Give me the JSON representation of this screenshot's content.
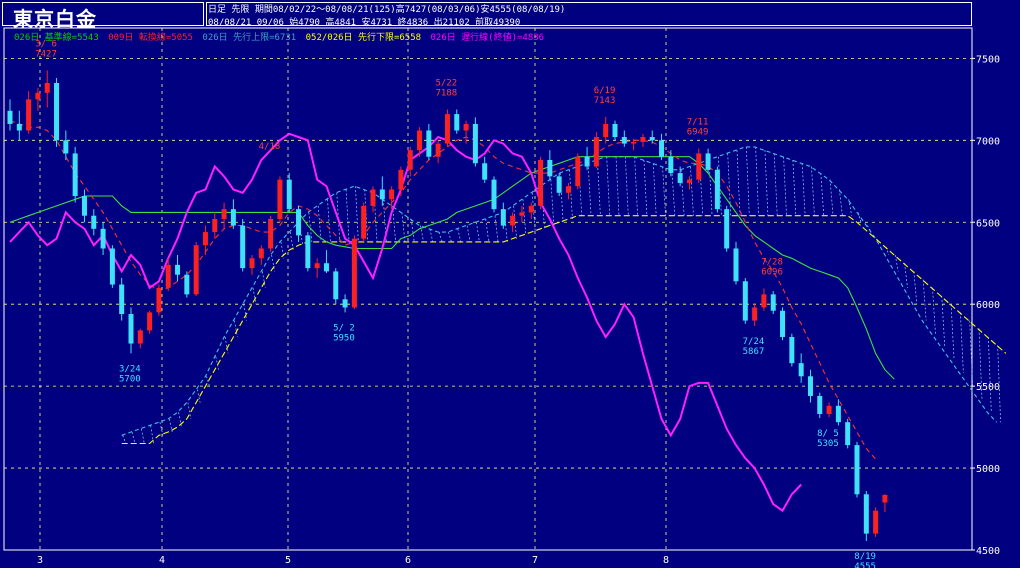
{
  "header": {
    "title": "東京白金",
    "info_line1": "日足 先限 期間08/02/22〜08/08/21(125)高7427(08/03/06)安4555(08/08/19)",
    "info_line2": "08/08/21 09/06 始4790 高4841 安4731 終4836 出21102 前取49390"
  },
  "legend": {
    "items": [
      {
        "label": "026日 基準線=5543",
        "color": "#00d000"
      },
      {
        "label": "009日 転換線=5055",
        "color": "#ff2020"
      },
      {
        "label": "026日 先行上限=6731",
        "color": "#40a0c0"
      },
      {
        "label": "052/026日 先行下限=6558",
        "color": "#ffff00"
      },
      {
        "label": "026日 遅行線(終値)=4836",
        "color": "#ff00ff"
      }
    ]
  },
  "chart_data": {
    "type": "candlestick",
    "ylim": [
      4500,
      7600
    ],
    "yticks": [
      4500,
      5000,
      5500,
      6000,
      6500,
      7000,
      7500
    ],
    "xticks": [
      "3",
      "4",
      "5",
      "6",
      "7",
      "8"
    ],
    "grid": true,
    "annotations": [
      {
        "label": "3/ 6",
        "value": "7427",
        "price": 7427,
        "color": "#ff4040"
      },
      {
        "label": "3/24",
        "value": "5700",
        "price": 5700,
        "color": "#40e0ff"
      },
      {
        "label": "4/18",
        "value": "",
        "price": 6800,
        "color": "#ff4040"
      },
      {
        "label": "5/ 2",
        "value": "5950",
        "price": 5950,
        "color": "#40e0ff"
      },
      {
        "label": "5/22",
        "value": "7188",
        "price": 7188,
        "color": "#ff4040"
      },
      {
        "label": "6/19",
        "value": "7143",
        "price": 7143,
        "color": "#ff4040"
      },
      {
        "label": "7/11",
        "value": "6949",
        "price": 6949,
        "color": "#ff4040"
      },
      {
        "label": "7/28",
        "value": "6096",
        "price": 6096,
        "color": "#ff4040"
      },
      {
        "label": "7/24",
        "value": "5867",
        "price": 5867,
        "color": "#40e0ff"
      },
      {
        "label": "8/ 5",
        "value": "5305",
        "price": 5305,
        "color": "#40e0ff"
      },
      {
        "label": "8/19",
        "value": "4555",
        "price": 4555,
        "color": "#40e0ff"
      }
    ],
    "candles": [
      [
        7180,
        7250,
        7060,
        7100
      ],
      [
        7100,
        7180,
        7000,
        7060
      ],
      [
        7060,
        7300,
        7040,
        7250
      ],
      [
        7250,
        7320,
        7180,
        7290
      ],
      [
        7290,
        7427,
        7200,
        7350
      ],
      [
        7350,
        7380,
        6960,
        7000
      ],
      [
        7000,
        7060,
        6880,
        6920
      ],
      [
        6920,
        6960,
        6620,
        6660
      ],
      [
        6660,
        6700,
        6500,
        6540
      ],
      [
        6540,
        6580,
        6420,
        6460
      ],
      [
        6460,
        6500,
        6300,
        6340
      ],
      [
        6340,
        6360,
        6100,
        6120
      ],
      [
        6120,
        6160,
        5900,
        5940
      ],
      [
        5940,
        5980,
        5700,
        5760
      ],
      [
        5760,
        5850,
        5730,
        5840
      ],
      [
        5840,
        5960,
        5820,
        5950
      ],
      [
        5950,
        6120,
        5930,
        6100
      ],
      [
        6100,
        6280,
        6080,
        6240
      ],
      [
        6240,
        6300,
        6140,
        6180
      ],
      [
        6180,
        6200,
        6040,
        6060
      ],
      [
        6060,
        6380,
        6050,
        6360
      ],
      [
        6360,
        6480,
        6300,
        6440
      ],
      [
        6440,
        6560,
        6400,
        6520
      ],
      [
        6520,
        6620,
        6460,
        6580
      ],
      [
        6580,
        6640,
        6460,
        6480
      ],
      [
        6480,
        6520,
        6200,
        6220
      ],
      [
        6220,
        6300,
        6180,
        6280
      ],
      [
        6280,
        6360,
        6240,
        6340
      ],
      [
        6340,
        6540,
        6320,
        6520
      ],
      [
        6520,
        6780,
        6500,
        6760
      ],
      [
        6760,
        6800,
        6560,
        6580
      ],
      [
        6580,
        6600,
        6380,
        6420
      ],
      [
        6420,
        6440,
        6200,
        6220
      ],
      [
        6220,
        6280,
        6160,
        6250
      ],
      [
        6250,
        6330,
        6190,
        6200
      ],
      [
        6200,
        6220,
        6000,
        6030
      ],
      [
        6030,
        6060,
        5950,
        5980
      ],
      [
        5980,
        6420,
        5970,
        6400
      ],
      [
        6400,
        6620,
        6380,
        6600
      ],
      [
        6600,
        6720,
        6560,
        6700
      ],
      [
        6700,
        6780,
        6600,
        6640
      ],
      [
        6640,
        6720,
        6580,
        6700
      ],
      [
        6700,
        6840,
        6660,
        6820
      ],
      [
        6820,
        6960,
        6780,
        6940
      ],
      [
        6940,
        7080,
        6900,
        7060
      ],
      [
        7060,
        7100,
        6880,
        6900
      ],
      [
        6900,
        7000,
        6860,
        6980
      ],
      [
        6980,
        7188,
        6960,
        7160
      ],
      [
        7160,
        7188,
        7040,
        7060
      ],
      [
        7060,
        7120,
        6980,
        7100
      ],
      [
        7100,
        7140,
        6840,
        6860
      ],
      [
        6860,
        6900,
        6740,
        6760
      ],
      [
        6760,
        6780,
        6560,
        6580
      ],
      [
        6580,
        6620,
        6460,
        6480
      ],
      [
        6480,
        6560,
        6440,
        6540
      ],
      [
        6540,
        6600,
        6500,
        6560
      ],
      [
        6560,
        6620,
        6520,
        6600
      ],
      [
        6600,
        6900,
        6580,
        6880
      ],
      [
        6880,
        6940,
        6760,
        6780
      ],
      [
        6780,
        6800,
        6660,
        6680
      ],
      [
        6680,
        6740,
        6640,
        6720
      ],
      [
        6720,
        6920,
        6700,
        6900
      ],
      [
        6900,
        6960,
        6820,
        6840
      ],
      [
        6840,
        7050,
        6830,
        7020
      ],
      [
        7020,
        7143,
        6980,
        7100
      ],
      [
        7100,
        7120,
        7000,
        7020
      ],
      [
        7020,
        7060,
        6960,
        6980
      ],
      [
        6980,
        7010,
        6940,
        6990
      ],
      [
        6990,
        7040,
        6960,
        7020
      ],
      [
        7020,
        7060,
        6980,
        7000
      ],
      [
        7000,
        7040,
        6880,
        6900
      ],
      [
        6900,
        6940,
        6780,
        6800
      ],
      [
        6800,
        6840,
        6720,
        6740
      ],
      [
        6740,
        6780,
        6700,
        6760
      ],
      [
        6760,
        6949,
        6740,
        6920
      ],
      [
        6920,
        6949,
        6800,
        6820
      ],
      [
        6820,
        6840,
        6560,
        6580
      ],
      [
        6580,
        6600,
        6320,
        6340
      ],
      [
        6340,
        6380,
        6120,
        6140
      ],
      [
        6140,
        6160,
        5880,
        5900
      ],
      [
        5900,
        6000,
        5867,
        5980
      ],
      [
        5980,
        6096,
        5960,
        6060
      ],
      [
        6060,
        6080,
        5940,
        5960
      ],
      [
        5960,
        5980,
        5780,
        5800
      ],
      [
        5800,
        5820,
        5620,
        5640
      ],
      [
        5640,
        5700,
        5520,
        5560
      ],
      [
        5560,
        5600,
        5400,
        5440
      ],
      [
        5440,
        5460,
        5305,
        5330
      ],
      [
        5330,
        5400,
        5310,
        5380
      ],
      [
        5380,
        5420,
        5260,
        5280
      ],
      [
        5280,
        5300,
        5120,
        5140
      ],
      [
        5140,
        5160,
        4820,
        4840
      ],
      [
        4840,
        4860,
        4555,
        4600
      ],
      [
        4600,
        4760,
        4580,
        4740
      ],
      [
        4790,
        4841,
        4731,
        4836
      ]
    ],
    "tenkan_line": [
      7120,
      7100,
      7080,
      7080,
      7060,
      7000,
      6900,
      6800,
      6720,
      6640,
      6560,
      6460,
      6360,
      6260,
      6180,
      6120,
      6080,
      6100,
      6140,
      6180,
      6240,
      6320,
      6400,
      6460,
      6480,
      6480,
      6460,
      6440,
      6440,
      6480,
      6560,
      6600,
      6580,
      6540,
      6480,
      6420,
      6360,
      6380,
      6420,
      6500,
      6560,
      6620,
      6680,
      6760,
      6820,
      6880,
      6920,
      6960,
      7000,
      7020,
      7000,
      6960,
      6900,
      6860,
      6840,
      6820,
      6800,
      6800,
      6800,
      6820,
      6840,
      6860,
      6880,
      6920,
      6960,
      6980,
      6990,
      7000,
      7000,
      6990,
      6960,
      6920,
      6880,
      6860,
      6860,
      6840,
      6800,
      6720,
      6620,
      6500,
      6380,
      6280,
      6200,
      6100,
      5980,
      5880,
      5760,
      5640,
      5520,
      5420,
      5320,
      5220,
      5120,
      5055
    ],
    "kijun_line": [
      6500,
      6520,
      6540,
      6560,
      6580,
      6600,
      6620,
      6640,
      6660,
      6660,
      6660,
      6660,
      6600,
      6560,
      6560,
      6560,
      6560,
      6560,
      6560,
      6560,
      6560,
      6560,
      6560,
      6560,
      6560,
      6560,
      6560,
      6560,
      6560,
      6560,
      6560,
      6560,
      6480,
      6420,
      6380,
      6360,
      6350,
      6340,
      6340,
      6340,
      6340,
      6340,
      6400,
      6420,
      6460,
      6480,
      6500,
      6520,
      6560,
      6580,
      6600,
      6620,
      6640,
      6680,
      6720,
      6760,
      6800,
      6820,
      6840,
      6860,
      6880,
      6900,
      6900,
      6900,
      6900,
      6900,
      6900,
      6900,
      6900,
      6900,
      6900,
      6900,
      6900,
      6900,
      6860,
      6800,
      6720,
      6640,
      6560,
      6480,
      6420,
      6380,
      6340,
      6300,
      6280,
      6250,
      6220,
      6200,
      6180,
      6160,
      6100,
      5980,
      5850,
      5700,
      5600,
      5543
    ],
    "span_a": [
      5200,
      5220,
      5240,
      5260,
      5280,
      5300,
      5340,
      5400,
      5480,
      5560,
      5680,
      5800,
      5900,
      6000,
      6100,
      6200,
      6300,
      6380,
      6440,
      6500,
      6560,
      6600,
      6640,
      6680,
      6700,
      6720,
      6700,
      6680,
      6640,
      6600,
      6560,
      6520,
      6480,
      6460,
      6440,
      6440,
      6460,
      6480,
      6500,
      6520,
      6540,
      6560,
      6600,
      6640,
      6680,
      6720,
      6760,
      6800,
      6820,
      6840,
      6860,
      6880,
      6900,
      6900,
      6900,
      6900,
      6880,
      6860,
      6840,
      6820,
      6820,
      6840,
      6860,
      6880,
      6900,
      6920,
      6940,
      6960,
      6960,
      6940,
      6920,
      6900,
      6880,
      6860,
      6840,
      6800,
      6760,
      6700,
      6640,
      6560,
      6480,
      6400,
      6300,
      6200,
      6100,
      6000,
      5900,
      5820,
      5740,
      5660,
      5580,
      5500,
      5420,
      5340,
      5280
    ],
    "span_b": [
      5150,
      5150,
      5150,
      5150,
      5200,
      5220,
      5250,
      5300,
      5400,
      5500,
      5600,
      5700,
      5800,
      5900,
      6000,
      6100,
      6200,
      6280,
      6330,
      6360,
      6380,
      6380,
      6380,
      6380,
      6380,
      6380,
      6380,
      6380,
      6380,
      6380,
      6380,
      6380,
      6380,
      6380,
      6380,
      6380,
      6380,
      6380,
      6380,
      6380,
      6380,
      6380,
      6400,
      6420,
      6440,
      6460,
      6480,
      6500,
      6520,
      6540,
      6540,
      6540,
      6540,
      6540,
      6540,
      6540,
      6540,
      6540,
      6540,
      6540,
      6540,
      6540,
      6540,
      6540,
      6540,
      6540,
      6540,
      6540,
      6540,
      6540,
      6540,
      6540,
      6540,
      6540,
      6540,
      6540,
      6540,
      6540,
      6540,
      6500,
      6450,
      6400,
      6350,
      6300,
      6250,
      6200,
      6150,
      6100,
      6050,
      6000,
      5950,
      5900,
      5850,
      5800,
      5750,
      5700
    ],
    "chikou_line": [
      6380,
      6440,
      6500,
      6420,
      6360,
      6400,
      6560,
      6500,
      6460,
      6360,
      6420,
      6300,
      6200,
      6300,
      6240,
      6100,
      6140,
      6280,
      6400,
      6560,
      6680,
      6700,
      6840,
      6780,
      6700,
      6680,
      6760,
      6880,
      6940,
      7000,
      7040,
      7020,
      7000,
      6760,
      6720,
      6560,
      6400,
      6360,
      6260,
      6160,
      6340,
      6560,
      6700,
      6880,
      6920,
      6960,
      7020,
      7000,
      6940,
      6900,
      6880,
      6920,
      7000,
      6980,
      6920,
      6900,
      6800,
      6620,
      6520,
      6400,
      6300,
      6160,
      6040,
      5900,
      5800,
      5880,
      6000,
      5920,
      5700,
      5500,
      5300,
      5200,
      5300,
      5500,
      5520,
      5520,
      5380,
      5240,
      5140,
      5060,
      5000,
      4900,
      4780,
      4740,
      4840,
      4900
    ]
  }
}
